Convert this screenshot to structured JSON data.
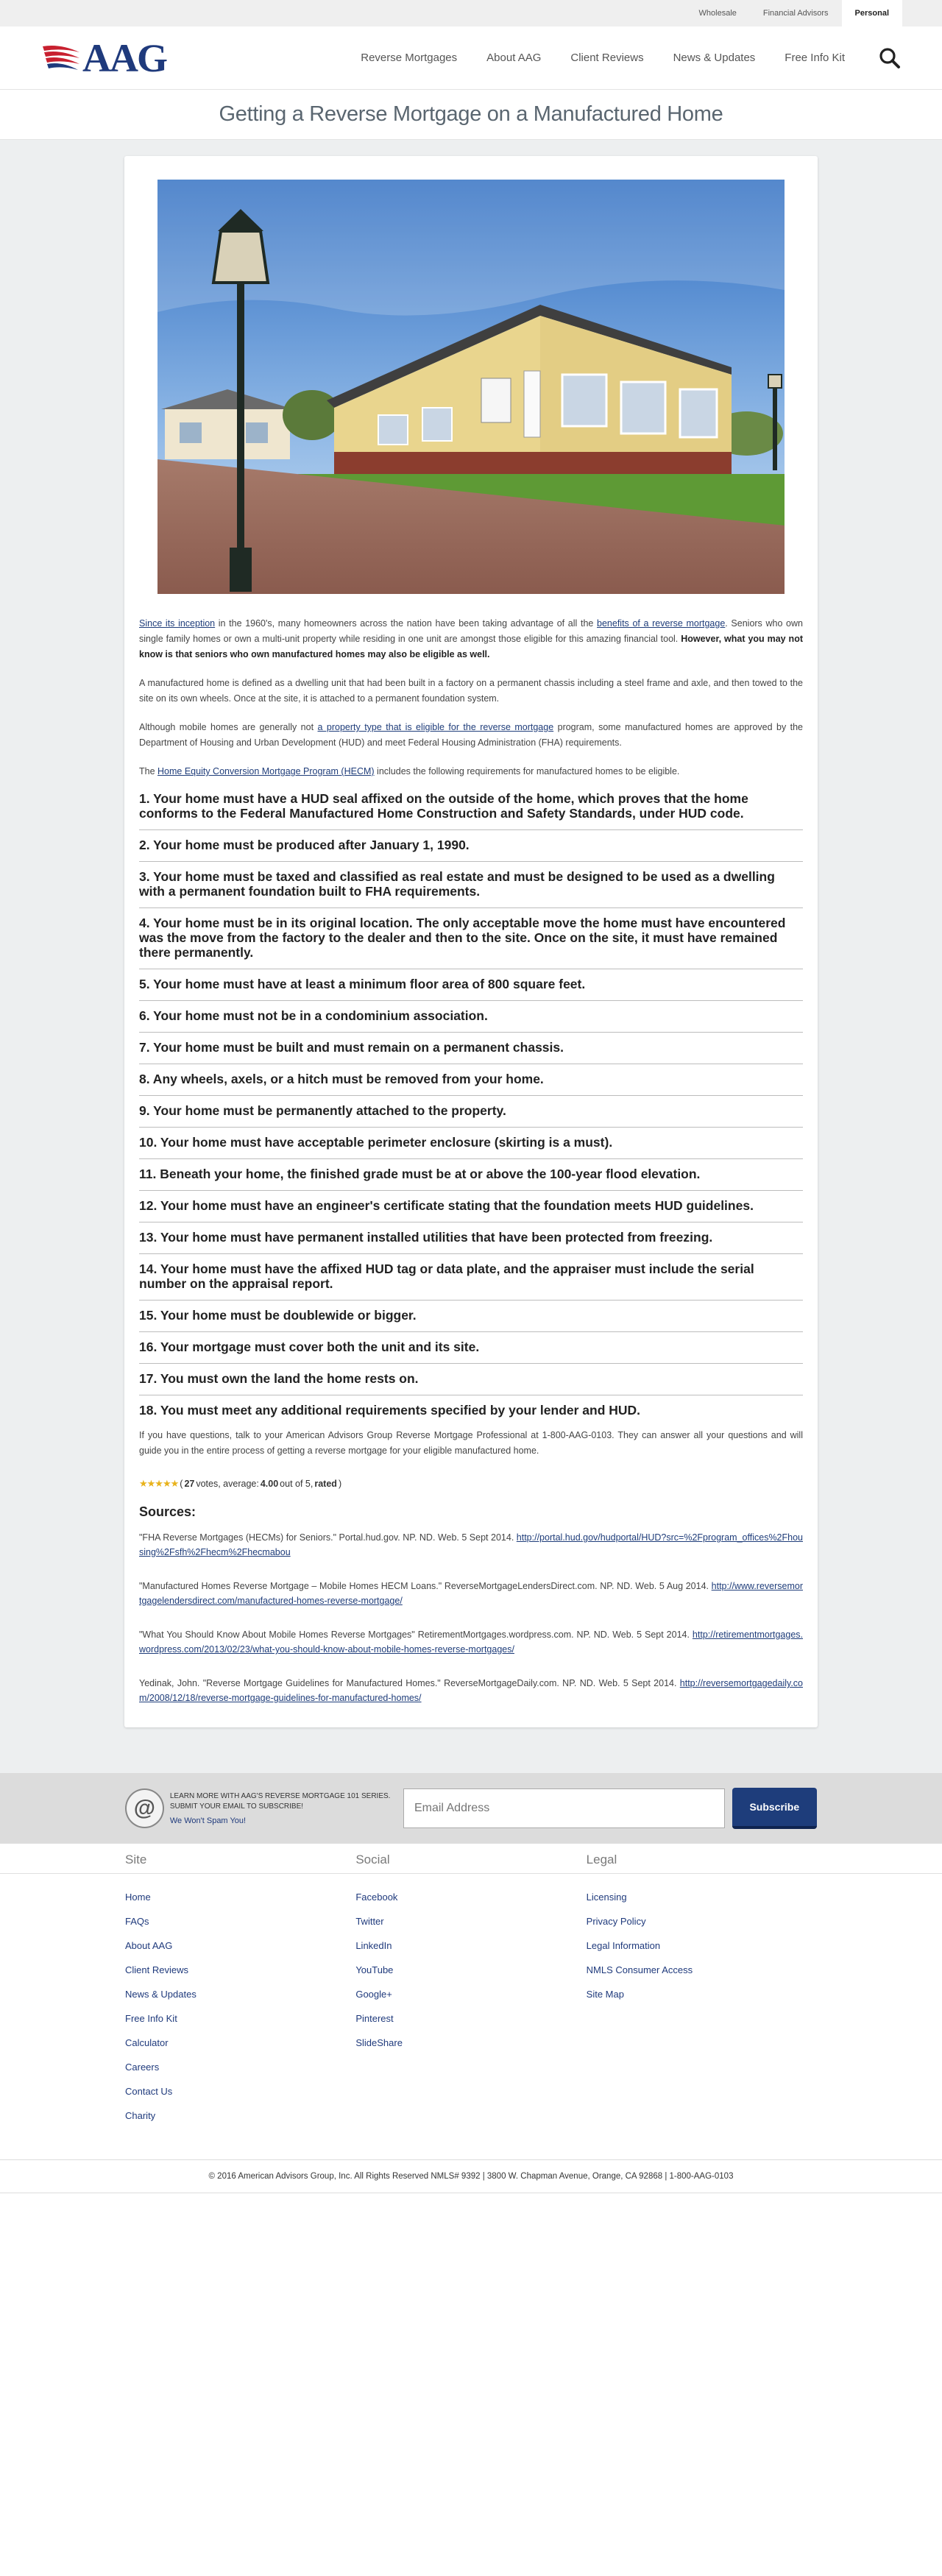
{
  "utility": {
    "links": [
      "Wholesale",
      "Financial Advisors",
      "Personal"
    ]
  },
  "header": {
    "logo_text": "AAG",
    "nav": [
      "Reverse Mortgages",
      "About AAG",
      "Client Reviews",
      "News & Updates",
      "Free Info Kit"
    ]
  },
  "page": {
    "title": "Getting a Reverse Mortgage on a Manufactured Home"
  },
  "article": {
    "intro_link1": "Since its inception",
    "intro_text1": " in the 1960's, many homeowners across the nation have been taking advantage of all the ",
    "intro_link2": "benefits of a reverse mortgage",
    "intro_text2": ". Seniors who own single family homes or own a multi-unit property while residing in one unit are amongst those eligible for this amazing financial tool. ",
    "intro_bold": "However, what you may not know is that seniors who own manufactured homes may also be eligible as well.",
    "para2": "A manufactured home is defined as a dwelling unit that had been built in a factory on a permanent chassis including a steel frame and axle, and then towed to the site on its own wheels. Once at the site, it is attached to a permanent foundation system.",
    "para3_a": "Although mobile homes are generally not ",
    "para3_link": "a property type that is eligible for the reverse mortgage",
    "para3_b": " program, some manufactured homes are approved by the Department of Housing and Urban Development (HUD) and meet Federal Housing Administration (FHA) requirements.",
    "para4_a": "The ",
    "para4_link": "Home Equity Conversion Mortgage Program (HECM)",
    "para4_b": " includes the following requirements for manufactured homes to be eligible.",
    "requirements": [
      "1. Your home must have a HUD seal affixed on the outside of the home, which proves that the home conforms to the Federal Manufactured Home Construction and Safety Standards, under HUD code.",
      "2. Your home must be produced after January 1, 1990.",
      "3. Your home must be taxed and classified as real estate and must be designed to be used as a dwelling with a permanent foundation built to FHA requirements.",
      "4. Your home must be in its original location. The only acceptable move the home must have encountered was the move from the factory to the dealer and then to the site. Once on the site, it must have remained there permanently.",
      "5. Your home must have at least a minimum floor area of 800 square feet.",
      "6. Your home must not be in a condominium association.",
      "7. Your home must be built and must remain on a permanent chassis.",
      "8. Any wheels, axels, or a hitch must be removed from your home.",
      "9. Your home must be permanently attached to the property.",
      "10. Your home must have acceptable perimeter enclosure (skirting is a must).",
      "11. Beneath your home, the finished grade must be at or above the 100-year flood elevation.",
      "12. Your home must have an engineer's certificate stating that the foundation meets HUD guidelines.",
      "13. Your home must have permanent installed utilities that have been protected from freezing.",
      "14. Your home must have the affixed HUD tag or data plate, and the appraiser must include the serial number on the appraisal report.",
      "15. Your home must be doublewide or bigger.",
      "16. Your mortgage must cover both the unit and its site.",
      "17. You must own the land the home rests on.",
      "18. You must meet any additional requirements specified by your lender and HUD."
    ],
    "closing": "If you have questions, talk to your American Advisors Group Reverse Mortgage Professional at 1-800-AAG-0103. They can answer all your questions and will guide you in the entire process of getting a reverse mortgage for your eligible manufactured home.",
    "rating": {
      "stars": "★★★★★",
      "votes": "27",
      "text_a": " votes, average: ",
      "average": "4.00",
      "text_b": " out of 5, ",
      "rated": "rated",
      "close": ")",
      "open": "("
    },
    "sources_heading": "Sources:",
    "sources": [
      {
        "text": "\"FHA Reverse Mortgages (HECMs) for Seniors.\" Portal.hud.gov. NP. ND. Web. 5 Sept 2014. ",
        "link": "http://portal.hud.gov/hudportal/HUD?src=%2Fprogram_offices%2Fhousing%2Fsfh%2Fhecm%2Fhecmabou"
      },
      {
        "text": "\"Manufactured Homes Reverse Mortgage – Mobile Homes HECM Loans.\" ReverseMortgageLendersDirect.com. NP. ND. Web. 5 Aug 2014. ",
        "link": "http://www.reversemortgagelendersdirect.com/manufactured-homes-reverse-mortgage/"
      },
      {
        "text": "\"What You Should Know About Mobile Homes Reverse Mortgages\" RetirementMortgages.wordpress.com. NP. ND. Web. 5 Sept 2014. ",
        "link": "http://retirementmortgages.wordpress.com/2013/02/23/what-you-should-know-about-mobile-homes-reverse-mortgages/"
      },
      {
        "text": "Yedinak, John. \"Reverse Mortgage Guidelines for Manufactured Homes.\" ReverseMortgageDaily.com. NP. ND. Web. 5 Sept 2014. ",
        "link": "http://reversemortgagedaily.com/2008/12/18/reverse-mortgage-guidelines-for-manufactured-homes/"
      }
    ]
  },
  "newsletter": {
    "line1": "Learn more with AAG's Reverse Mortgage 101 series. Submit your email to subscribe!",
    "line2": "We Won't Spam You!",
    "placeholder": "Email Address",
    "button": "Subscribe"
  },
  "footer": {
    "site_heading": "Site",
    "site_links": [
      "Home",
      "FAQs",
      "About AAG",
      "Client Reviews",
      "News & Updates",
      "Free Info Kit",
      "Calculator",
      "Careers",
      "Contact Us",
      "Charity"
    ],
    "social_heading": "Social",
    "social_links": [
      "Facebook",
      "Twitter",
      "LinkedIn",
      "YouTube",
      "Google+",
      "Pinterest",
      "SlideShare"
    ],
    "legal_heading": "Legal",
    "legal_links": [
      "Licensing",
      "Privacy Policy",
      "Legal Information",
      "NMLS Consumer Access",
      "Site Map"
    ],
    "copyright": "© 2016 American Advisors Group, Inc. All Rights Reserved NMLS# 9392 | 3800 W. Chapman Avenue, Orange, CA 92868 | 1-800-AAG-0103"
  },
  "colors": {
    "brand_blue": "#1f3a7c",
    "brand_red": "#c8202f",
    "page_bg": "#edeff0"
  }
}
